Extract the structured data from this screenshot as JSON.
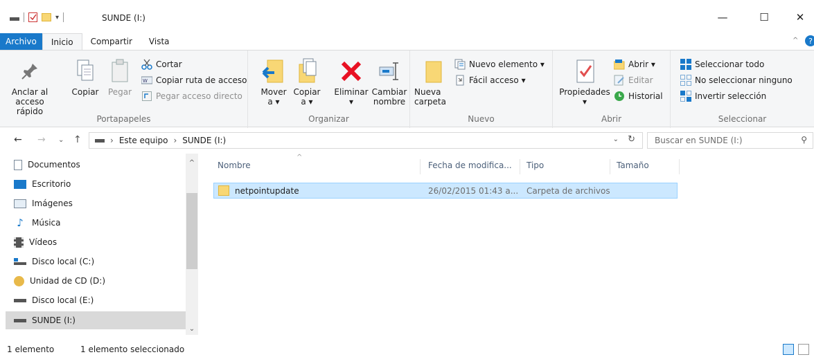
{
  "window": {
    "title": "SUNDE (I:)",
    "minimize_glyph": "—",
    "maximize_glyph": "☐",
    "close_glyph": "✕"
  },
  "tabs": [
    {
      "label": "Archivo"
    },
    {
      "label": "Inicio"
    },
    {
      "label": "Compartir"
    },
    {
      "label": "Vista"
    }
  ],
  "ribbon": {
    "portapapeles": {
      "label": "Portapapeles",
      "pin": "Anclar al acceso rápido",
      "pin_l1": "Anclar al",
      "pin_l2": "acceso rápido",
      "copy": "Copiar",
      "paste": "Pegar",
      "cut": "Cortar",
      "copy_path": "Copiar ruta de acceso",
      "paste_shortcut": "Pegar acceso directo"
    },
    "organizar": {
      "label": "Organizar",
      "move_l1": "Mover",
      "move_l2": "a ▾",
      "copyto_l1": "Copiar",
      "copyto_l2": "a ▾",
      "delete_l1": "Eliminar",
      "delete_l2": "▾",
      "rename_l1": "Cambiar",
      "rename_l2": "nombre"
    },
    "nuevo": {
      "label": "Nuevo",
      "newfolder_l1": "Nueva",
      "newfolder_l2": "carpeta",
      "new_item": "Nuevo elemento ▾",
      "easy_access": "Fácil acceso ▾"
    },
    "abrir": {
      "label": "Abrir",
      "properties": "Propiedades",
      "properties_arrow": "▾",
      "open": "Abrir ▾",
      "edit": "Editar",
      "history": "Historial"
    },
    "seleccionar": {
      "label": "Seleccionar",
      "select_all": "Seleccionar todo",
      "select_none": "No seleccionar ninguno",
      "invert": "Invertir selección"
    }
  },
  "address": {
    "crumbs": [
      "Este equipo",
      "SUNDE (I:)"
    ],
    "search_placeholder": "Buscar en SUNDE (I:)"
  },
  "nav": {
    "items": [
      {
        "label": "Documentos",
        "icon": "documents-icon"
      },
      {
        "label": "Escritorio",
        "icon": "desktop-icon"
      },
      {
        "label": "Imágenes",
        "icon": "pictures-icon"
      },
      {
        "label": "Música",
        "icon": "music-icon"
      },
      {
        "label": "Vídeos",
        "icon": "videos-icon"
      },
      {
        "label": "Disco local (C:)",
        "icon": "drive-c-icon"
      },
      {
        "label": "Unidad de CD (D:)",
        "icon": "cd-drive-icon"
      },
      {
        "label": "Disco local (E:)",
        "icon": "drive-icon"
      },
      {
        "label": "SUNDE (I:)",
        "icon": "usb-drive-icon"
      }
    ]
  },
  "filelist": {
    "columns": [
      "Nombre",
      "Fecha de modifica...",
      "Tipo",
      "Tamaño"
    ],
    "rows": [
      {
        "name": "netpointupdate",
        "date": "26/02/2015 01:43 a...",
        "type": "Carpeta de archivos",
        "size": ""
      }
    ]
  },
  "status": {
    "count": "1 elemento",
    "selected": "1 elemento seleccionado"
  },
  "colors": {
    "file_tab": "#1979ca",
    "selection": "#cce8ff",
    "folder": "#f8d775",
    "delete_red": "#e81123"
  }
}
